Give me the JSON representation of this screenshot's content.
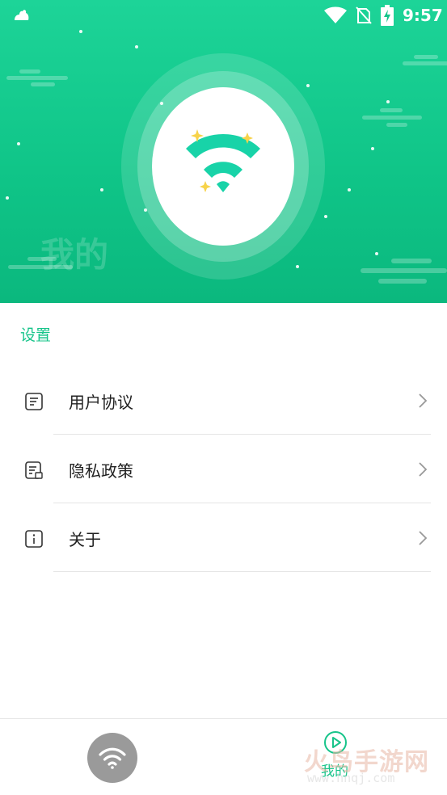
{
  "status_bar": {
    "time": "9:57",
    "icons": [
      "notification-icon",
      "wifi-signal-icon",
      "no-sim-icon",
      "battery-charging-icon"
    ]
  },
  "header": {
    "title": "我的",
    "logo_icon": "wifi-logo-icon"
  },
  "settings": {
    "section_title": "设置",
    "items": [
      {
        "label": "用户协议",
        "icon": "document-icon"
      },
      {
        "label": "隐私政策",
        "icon": "privacy-document-icon"
      },
      {
        "label": "关于",
        "icon": "info-icon"
      }
    ]
  },
  "bottom_nav": {
    "wifi_tab_icon": "wifi-icon",
    "mine_tab": {
      "label": "我的",
      "icon": "play-circle-icon"
    }
  },
  "watermark": {
    "main": "火鸟手游网",
    "sub": "www.hnqj.com"
  },
  "colors": {
    "accent": "#17c48a",
    "header_top": "#1dd498",
    "header_bottom": "#0bb87e",
    "nav_inactive": "#9a9a9a"
  }
}
